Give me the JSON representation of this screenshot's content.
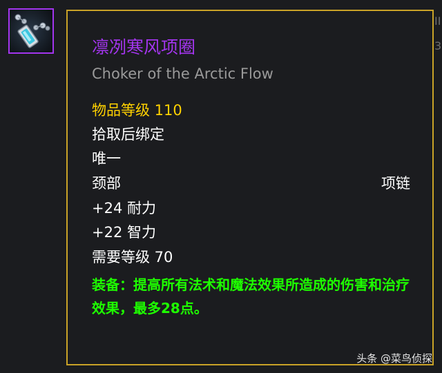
{
  "item": {
    "icon": "necklace-icon",
    "quality_color": "#a335ee",
    "name": "凛冽寒风项圈",
    "english_name": "Choker of the Arctic Flow",
    "item_level": "物品等级 110",
    "binding": "拾取后绑定",
    "unique": "唯一",
    "slot": "颈部",
    "slot_type": "项链",
    "stats": [
      "+24 耐力",
      "+22 智力"
    ],
    "requirement": "需要等级 70",
    "equip_effect": "装备：提高所有法术和魔法效果所造成的伤害和治疗效果，最多28点。"
  },
  "edge_fragments": [
    "II",
    "3"
  ],
  "watermark": "头条 @菜鸟侦探",
  "colors": {
    "epic": "#a335ee",
    "item_level": "#ffd100",
    "equip": "#1eff00",
    "border": "#c9a227",
    "english_name": "#9a9a9a"
  }
}
